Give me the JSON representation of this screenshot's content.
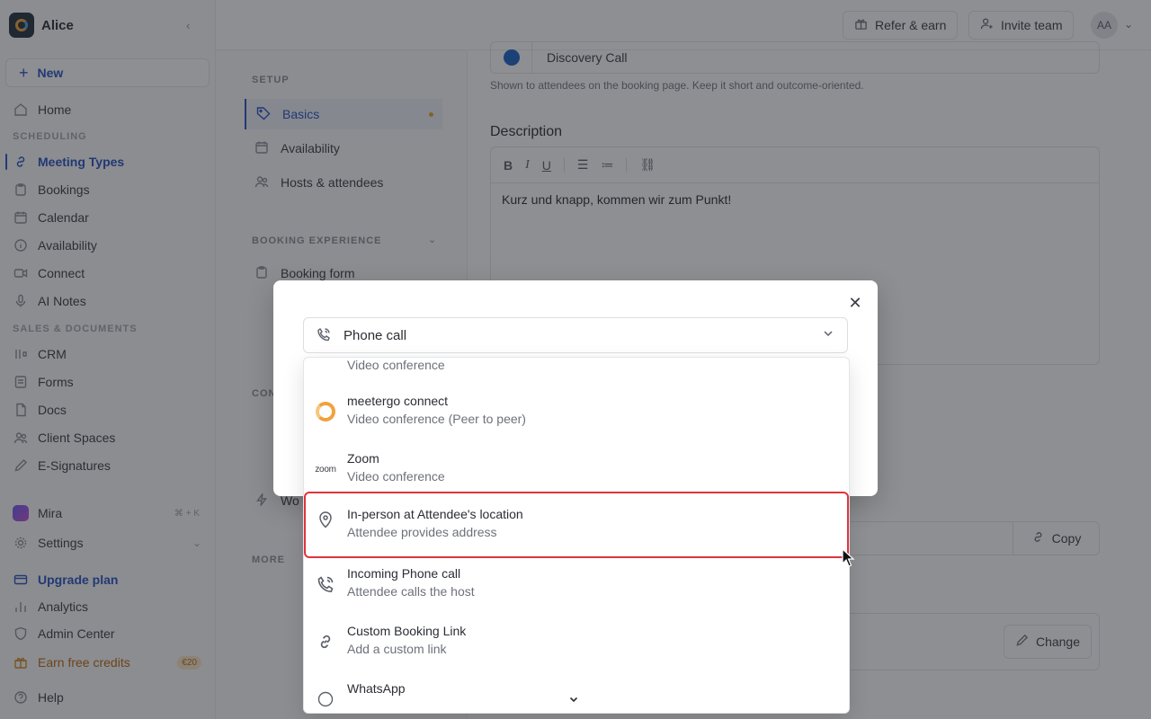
{
  "workspace": {
    "name": "Alice"
  },
  "sidebar": {
    "new_label": "New",
    "home": "Home",
    "scheduling_label": "SCHEDULING",
    "scheduling_items": [
      "Meeting Types",
      "Bookings",
      "Calendar",
      "Availability",
      "Connect",
      "AI Notes"
    ],
    "sales_label": "SALES & DOCUMENTS",
    "sales_items": [
      "CRM",
      "Forms",
      "Docs",
      "Client Spaces",
      "E-Signatures"
    ],
    "mira": "Mira",
    "mira_shortcut": "⌘ + K",
    "settings": "Settings",
    "upgrade": "Upgrade plan",
    "analytics": "Analytics",
    "admin_center": "Admin Center",
    "earn_credits": "Earn free credits",
    "earn_badge": "€20",
    "help": "Help"
  },
  "topbar": {
    "refer": "Refer & earn",
    "invite": "Invite team",
    "avatar_initials": "AA"
  },
  "subnav": {
    "setup_label": "SETUP",
    "setup_items": [
      "Basics",
      "Availability",
      "Hosts & attendees"
    ],
    "booking_label": "BOOKING EXPERIENCE",
    "booking_items": [
      "Booking form"
    ],
    "more_label": "MORE",
    "partial_label": "CON",
    "partial_item": "Wo"
  },
  "main": {
    "name_value": "Discovery Call",
    "name_hint": "Shown to attendees on the booking page. Keep it short and outcome-oriented.",
    "description_label": "Description",
    "description_text": "Kurz und knapp, kommen wir zum Punkt!",
    "copy_label": "Copy",
    "change_label": "Change"
  },
  "modal": {
    "selected": "Phone call",
    "options": [
      {
        "title": "",
        "subtitle": "Video conference",
        "icon": "video-icon"
      },
      {
        "title": "meetergo connect",
        "subtitle": "Video conference (Peer to peer)",
        "icon": "meetergo-logo"
      },
      {
        "title": "Zoom",
        "subtitle": "Video conference",
        "icon": "zoom-logo",
        "logo_text": "zoom"
      },
      {
        "title": "In-person at Attendee's location",
        "subtitle": "Attendee provides address",
        "icon": "map-pin-icon"
      },
      {
        "title": "Incoming Phone call",
        "subtitle": "Attendee calls the host",
        "icon": "phone-incoming-icon"
      },
      {
        "title": "Custom Booking Link",
        "subtitle": "Add a custom link",
        "icon": "link-icon"
      },
      {
        "title": "WhatsApp",
        "subtitle": "",
        "icon": "whatsapp-icon"
      }
    ]
  },
  "colors": {
    "accent": "#2452c4",
    "highlight": "#e0333d",
    "earn": "#b76b14"
  }
}
